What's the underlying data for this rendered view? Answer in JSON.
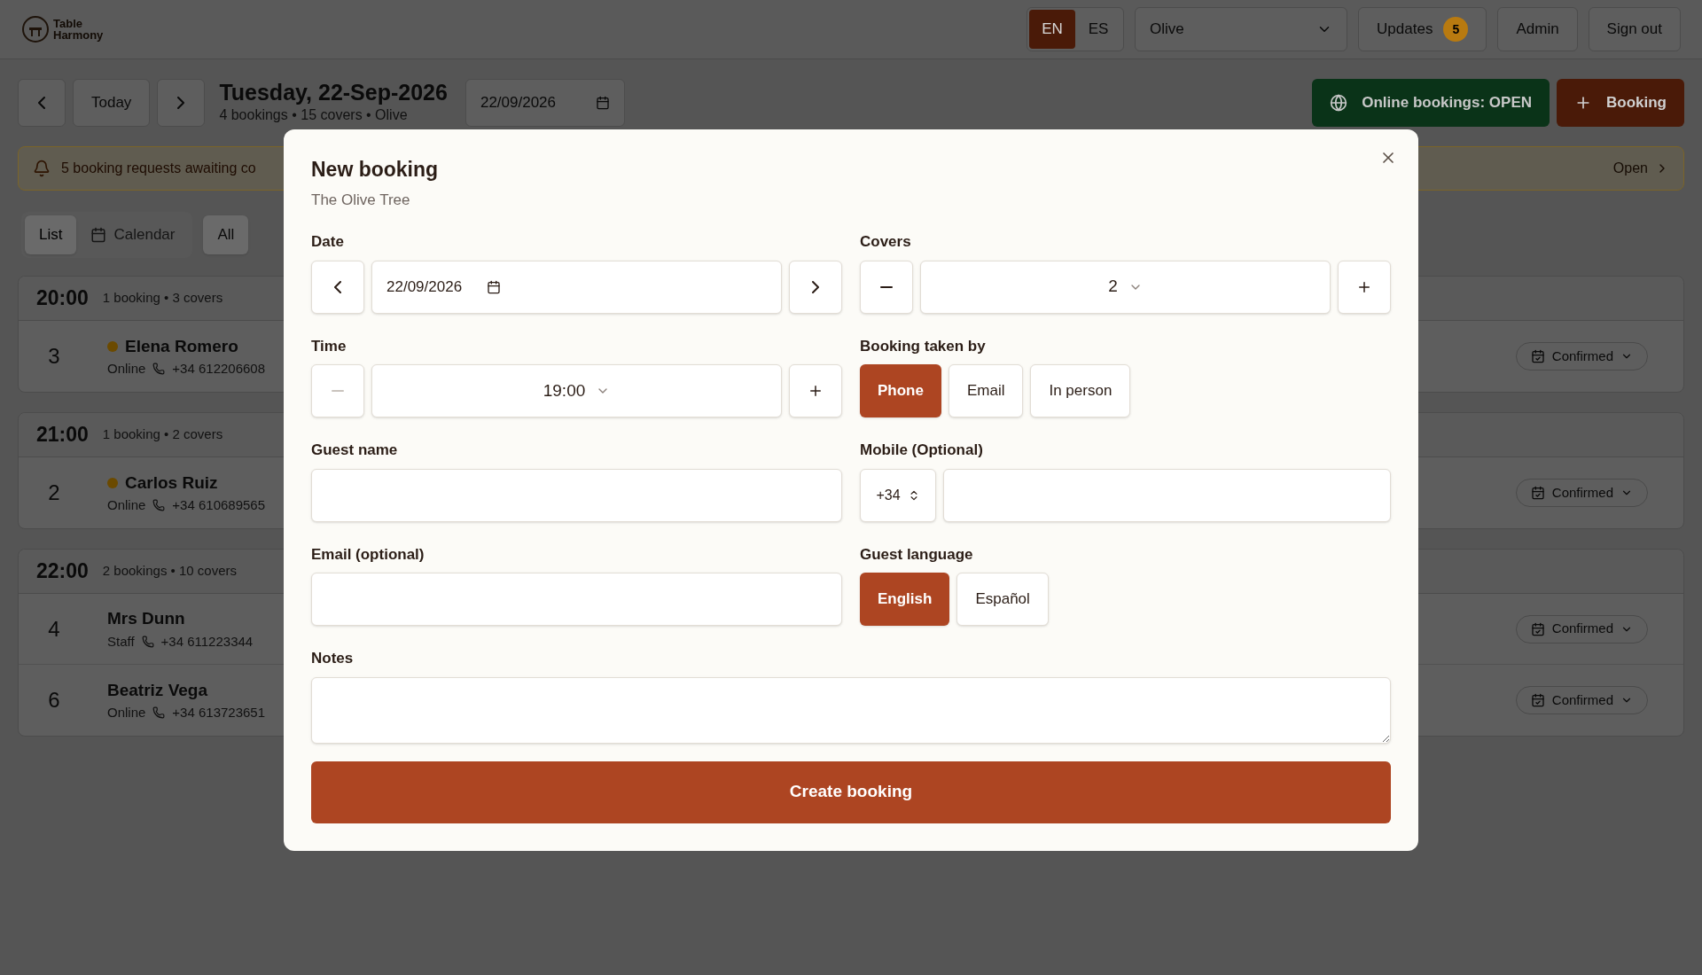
{
  "header": {
    "logo_lines": [
      "Table",
      "Harmony"
    ],
    "languages": [
      {
        "label": "EN",
        "selected": true
      },
      {
        "label": "ES",
        "selected": false
      }
    ],
    "restaurant": "Olive",
    "updates": {
      "label": "Updates",
      "count": "5"
    },
    "buttons": [
      "Admin",
      "Sign out"
    ]
  },
  "toolbar": {
    "today": "Today",
    "date_title": "Tuesday, 22-Sep-2026",
    "summary": "4 bookings • 15 covers • Olive",
    "date_value": "22/09/2026",
    "online": "Online bookings: OPEN",
    "new_booking": "Booking"
  },
  "alert": {
    "text": "5 booking requests awaiting co",
    "action": "Open"
  },
  "view_tabs": [
    {
      "label": "List",
      "selected": true,
      "kind": "text"
    },
    {
      "label": "Calendar",
      "selected": false,
      "kind": "calendar"
    }
  ],
  "filter": "All",
  "groups": [
    {
      "time": "20:00",
      "summary": "1 booking • 3 covers",
      "bookings": [
        {
          "covers": "3",
          "name": "Elena Romero",
          "source": "Online",
          "phone": "+34 612206608",
          "status": "Confirmed",
          "color": "#6b4a00"
        }
      ]
    },
    {
      "time": "21:00",
      "summary": "1 booking • 2 covers",
      "bookings": [
        {
          "covers": "2",
          "name": "Carlos Ruiz",
          "source": "Online",
          "phone": "+34 610689565",
          "status": "Confirmed",
          "color": "#6b4a00"
        }
      ]
    },
    {
      "time": "22:00",
      "summary": "2 bookings • 10 covers",
      "bookings": [
        {
          "covers": "4",
          "name": "Mrs Dunn",
          "source": "Staff",
          "phone": "+34 611223344",
          "status": "Confirmed"
        },
        {
          "covers": "6",
          "name": "Beatriz Vega",
          "source": "Online",
          "phone": "+34 613723651",
          "status": "Confirmed"
        }
      ]
    }
  ],
  "modal": {
    "title": "New booking",
    "subtitle": "The Olive Tree",
    "date": {
      "label": "Date",
      "value": "22/09/2026"
    },
    "covers": {
      "label": "Covers",
      "value": "2"
    },
    "time": {
      "label": "Time",
      "value": "19:00",
      "minus_disabled": true
    },
    "taken_by": {
      "label": "Booking taken by",
      "options": [
        {
          "label": "Phone",
          "selected": true
        },
        {
          "label": "Email",
          "selected": false
        },
        {
          "label": "In person",
          "selected": false
        }
      ]
    },
    "guest_name": {
      "label": "Guest name"
    },
    "mobile": {
      "label": "Mobile (Optional)",
      "prefix": "+34"
    },
    "email": {
      "label": "Email (optional)"
    },
    "language": {
      "label": "Guest language",
      "options": [
        {
          "label": "English",
          "selected": true
        },
        {
          "label": "Español",
          "selected": false
        }
      ]
    },
    "notes": {
      "label": "Notes"
    },
    "submit": "Create booking"
  }
}
